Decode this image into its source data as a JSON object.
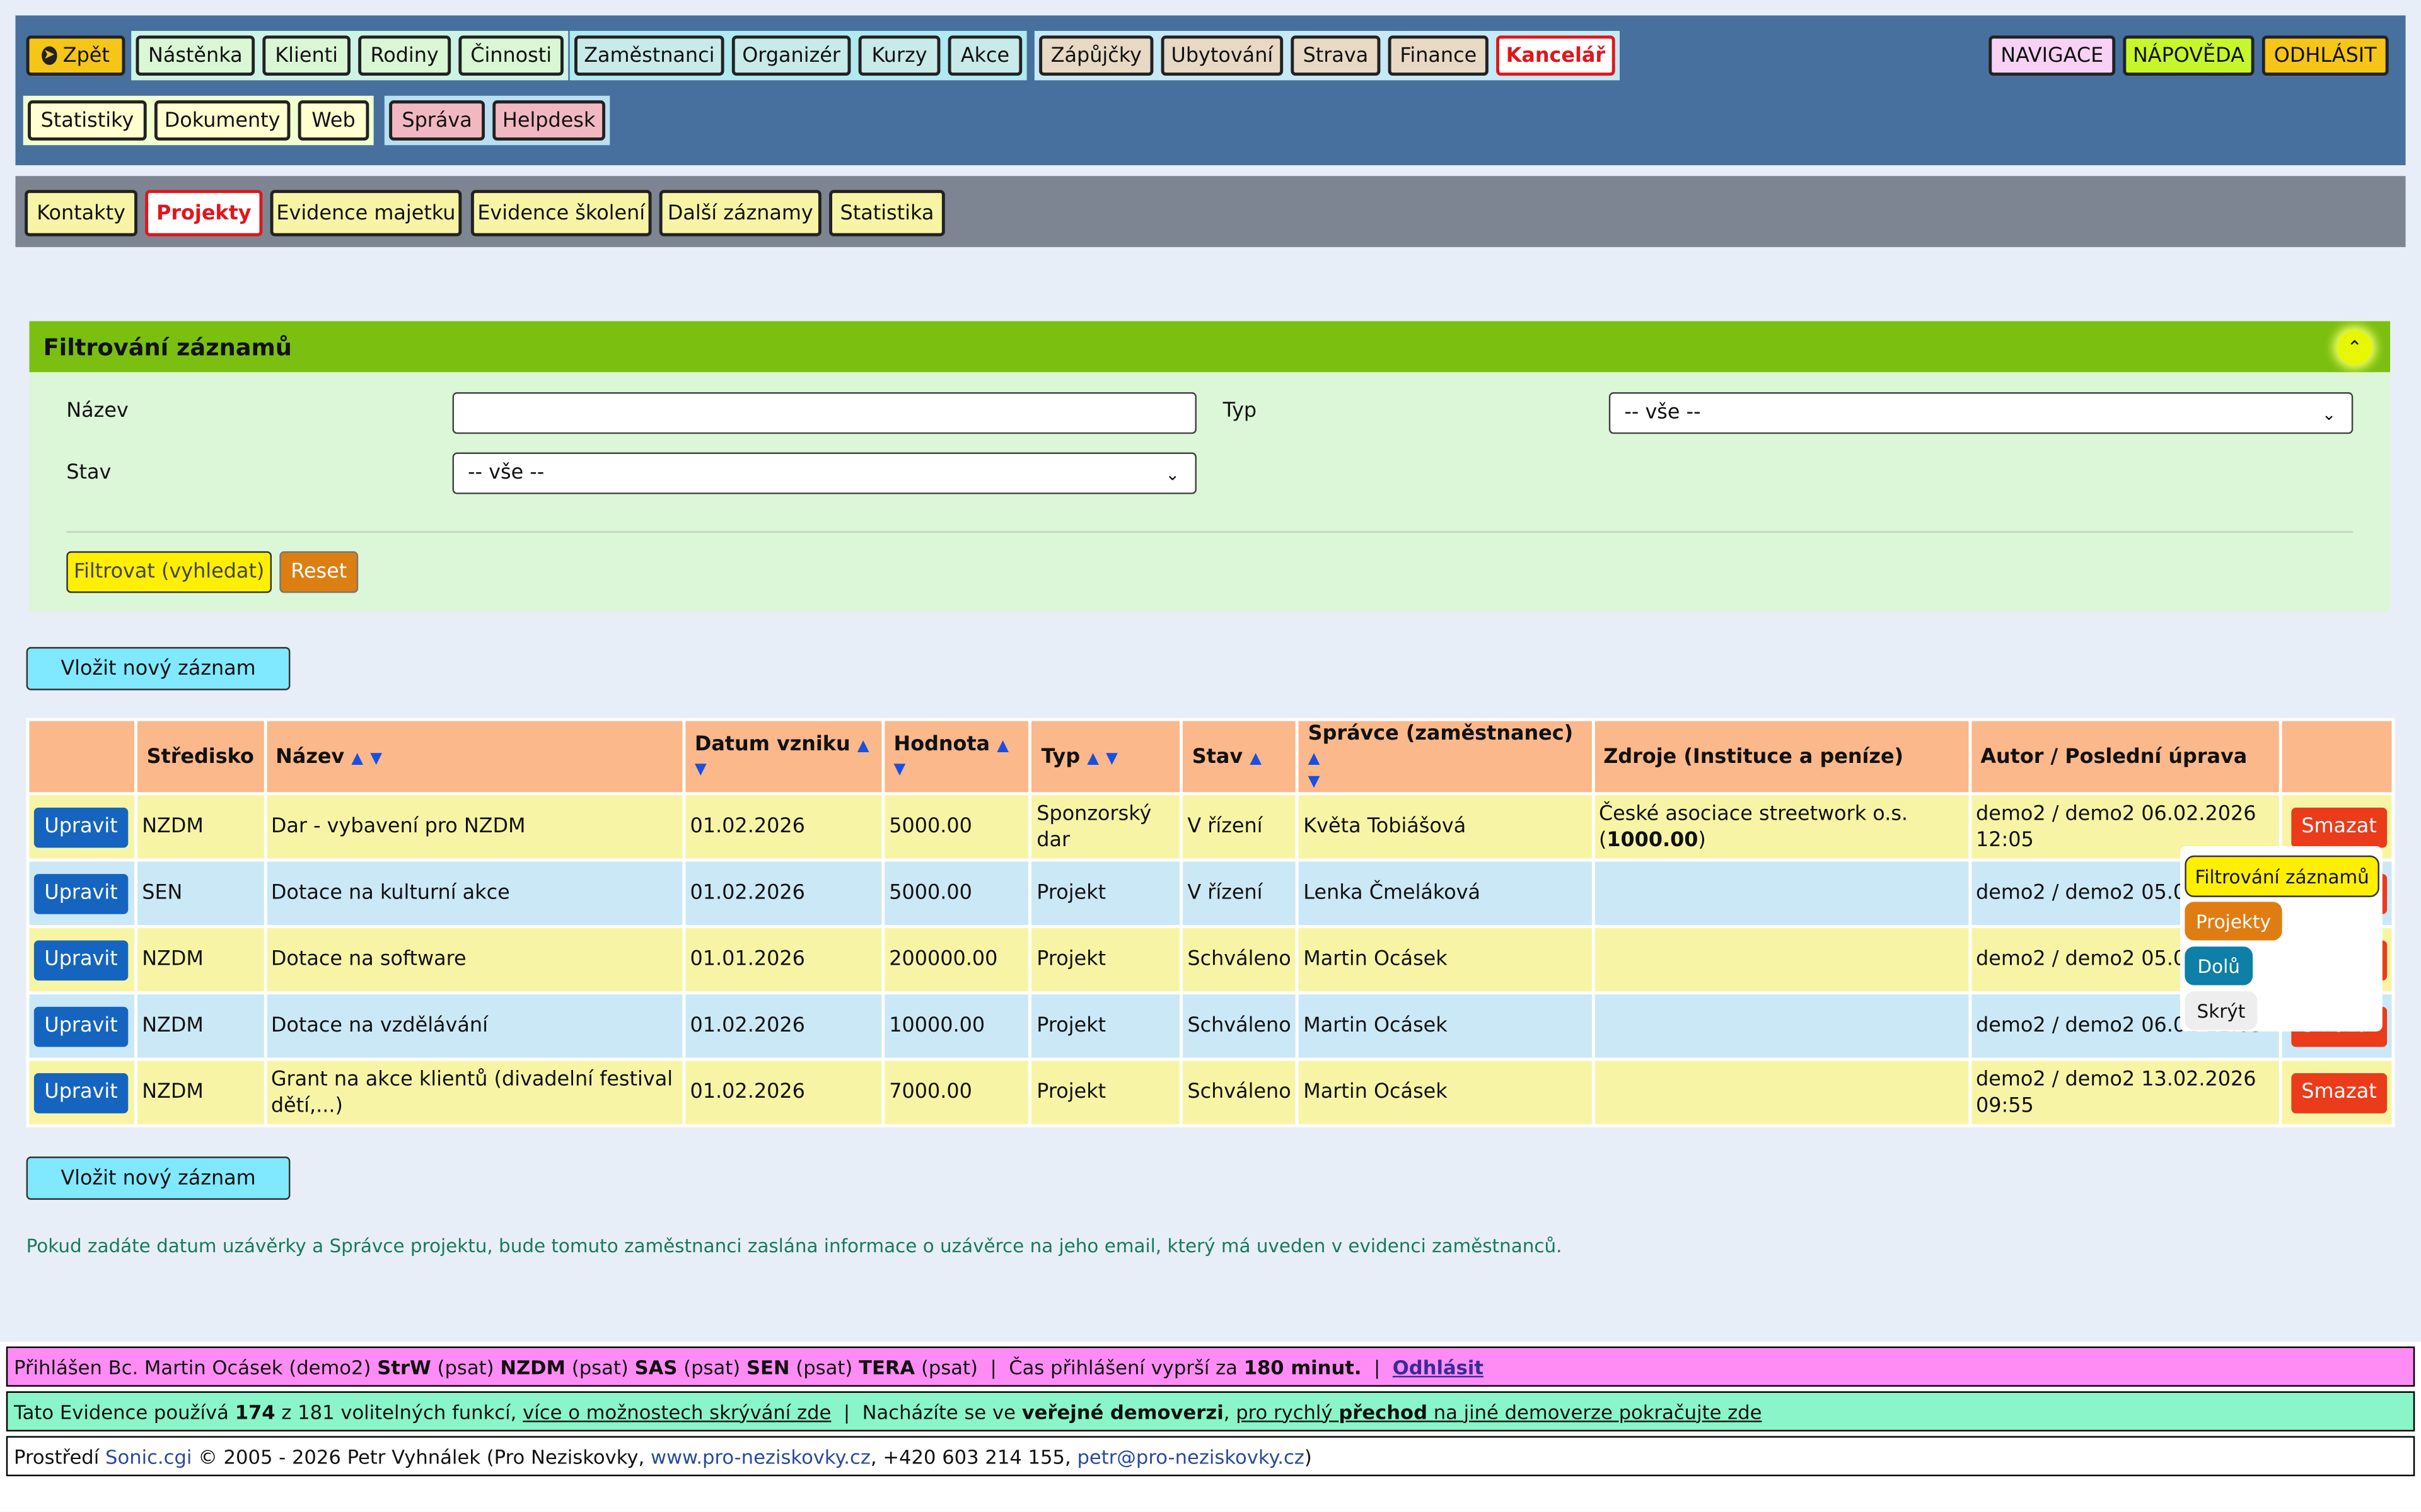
{
  "nav": {
    "back": "Zpět",
    "group1": [
      "Nástěnka",
      "Klienti",
      "Rodiny",
      "Činnosti"
    ],
    "group2": [
      "Zaměstnanci",
      "Organizér",
      "Kurzy",
      "Akce"
    ],
    "group3": [
      "Zápůjčky",
      "Ubytování",
      "Strava",
      "Finance",
      "Kancelář"
    ],
    "group4": [
      "Statistiky",
      "Dokumenty",
      "Web"
    ],
    "group5": [
      "Správa",
      "Helpdesk"
    ],
    "right": [
      "NAVIGACE",
      "NÁPOVĚDA",
      "ODHLÁSIT"
    ]
  },
  "subnav": [
    "Kontakty",
    "Projekty",
    "Evidence majetku",
    "Evidence školení",
    "Další záznamy",
    "Statistika"
  ],
  "filter": {
    "title": "Filtrování záznamů",
    "name_label": "Název",
    "name_value": "",
    "type_label": "Typ",
    "type_value": "-- vše --",
    "state_label": "Stav",
    "state_value": "-- vše --",
    "submit": "Filtrovat (vyhledat)",
    "reset": "Reset"
  },
  "insert_label": "Vložit nový záznam",
  "table": {
    "headers": [
      "Středisko",
      "Název",
      "Datum vzniku",
      "Hodnota",
      "Typ",
      "Stav",
      "Správce (zaměstnanec)",
      "Zdroje (Instituce a peníze)",
      "Autor / Poslední úprava"
    ],
    "edit_label": "Upravit",
    "delete_label": "Smazat",
    "rows": [
      {
        "center": "NZDM",
        "name": "Dar - vybavení pro NZDM",
        "date": "01.02.2026",
        "value": "5000.00",
        "type": "Sponzorský dar",
        "state": "V řízení",
        "manager": "Květa Tobiášová",
        "source": "České asociace streetwork o.s.",
        "source_amount": "1000.00",
        "author": "demo2 / demo2 06.02.2026 12:05"
      },
      {
        "center": "SEN",
        "name": "Dotace na kulturní akce",
        "date": "01.02.2026",
        "value": "5000.00",
        "type": "Projekt",
        "state": "V řízení",
        "manager": "Lenka Čmeláková",
        "source": "",
        "source_amount": "",
        "author": "demo2 / demo2 05.02 15:19"
      },
      {
        "center": "NZDM",
        "name": "Dotace na software",
        "date": "01.01.2026",
        "value": "200000.00",
        "type": "Projekt",
        "state": "Schváleno",
        "manager": "Martin Ocásek",
        "source": "",
        "source_amount": "",
        "author": "demo2 / demo2 05.02 12:51"
      },
      {
        "center": "NZDM",
        "name": "Dotace na vzdělávání",
        "date": "01.02.2026",
        "value": "10000.00",
        "type": "Projekt",
        "state": "Schváleno",
        "manager": "Martin Ocásek",
        "source": "",
        "source_amount": "",
        "author": "demo2 / demo2 06.02 12:03"
      },
      {
        "center": "NZDM",
        "name": "Grant na akce klientů (divadelní festival dětí,...)",
        "date": "01.02.2026",
        "value": "7000.00",
        "type": "Projekt",
        "state": "Schváleno",
        "manager": "Martin Ocásek",
        "source": "",
        "source_amount": "",
        "author": "demo2 / demo2 13.02.2026 09:55"
      }
    ]
  },
  "floating_menu": {
    "filter": "Filtrování záznamů",
    "projects": "Projekty",
    "down": "Dolů",
    "hide": "Skrýt"
  },
  "note": "Pokud zadáte datum uzávěrky a Správce projektu, bude tomuto zaměstnanci zaslána informace o uzávěrce na jeho email, který má uveden v evidenci zaměstnanců.",
  "footer": {
    "login_prefix": "Přihlášen Bc. Martin Ocásek (demo2)",
    "roles": [
      {
        "code": "StrW",
        "perm": "(psat)"
      },
      {
        "code": "NZDM",
        "perm": "(psat)"
      },
      {
        "code": "SAS",
        "perm": "(psat)"
      },
      {
        "code": "SEN",
        "perm": "(psat)"
      },
      {
        "code": "TERA",
        "perm": "(psat)"
      }
    ],
    "expire_text": "Čas přihlášení vyprší za",
    "expire_value": "180 minut.",
    "logout": "Odhlásit",
    "features_prefix": "Tato Evidence používá",
    "features_used": "174",
    "features_rest": "z 181 volitelných funkcí,",
    "features_link": "více o možnostech skrývání zde",
    "demo_prefix": "Nacházíte se ve",
    "demo_bold": "veřejné demoverzi",
    "demo_link_a": "pro rychlý",
    "demo_link_b": "přechod",
    "demo_link_c": "na jiné demoverze pokračujte zde",
    "env_prefix": "Prostředí",
    "env_name": "Sonic.cgi",
    "copyright": "© 2005 - 2026 Petr Vyhnálek (Pro Neziskovky,",
    "website": "www.pro-neziskovky.cz",
    "phone": ", +420 603 214 155,",
    "email": "petr@pro-neziskovky.cz",
    "close_paren": ")"
  },
  "colors": {
    "topbar": "#47709e",
    "active_tab_text": "#e0161b",
    "filter_header": "#7bbf11",
    "table_header": "#fbb88a",
    "row_yellow": "#f7f5a5",
    "row_blue": "#cbe8f6",
    "edit_button": "#1565c0",
    "delete_button": "#ea3b1b"
  }
}
